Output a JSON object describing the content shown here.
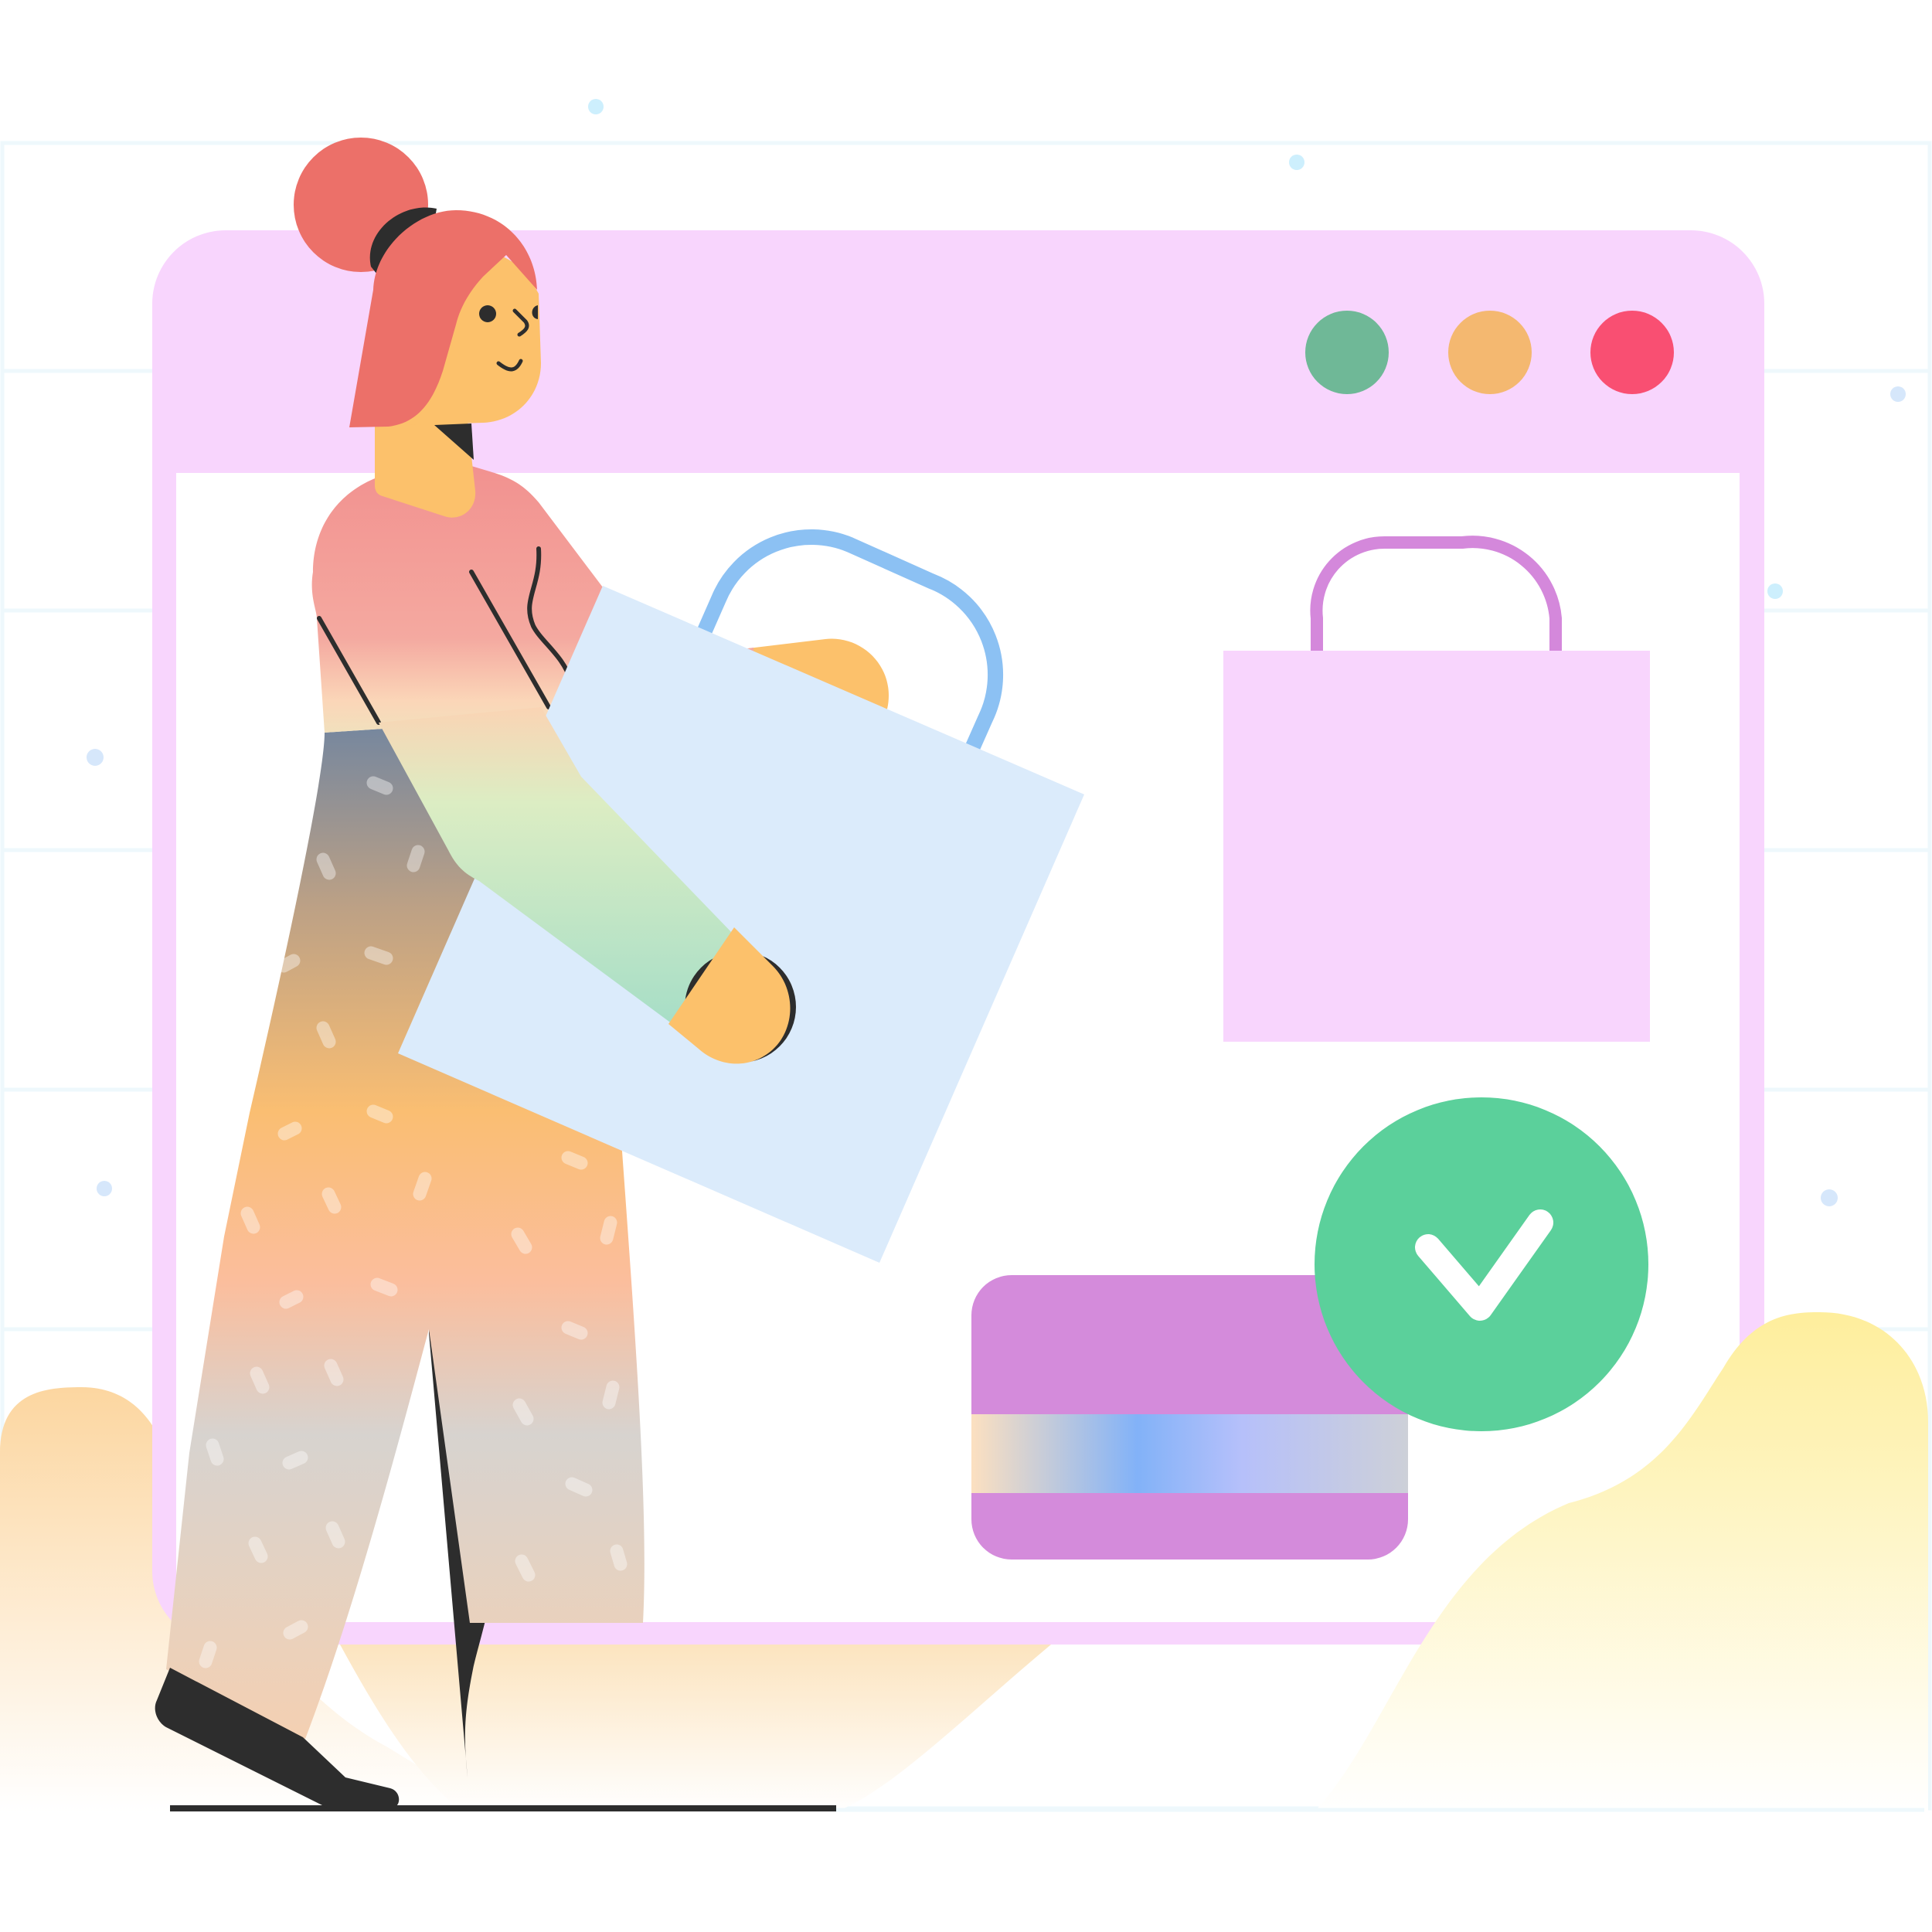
{
  "colors": {
    "background": "#ffffff",
    "grid_line": "#EEF8FC",
    "sparkle": "#CDEFFD",
    "window_frame": "#F8D5FD",
    "window_content": "#ffffff",
    "dot_green": "#6FB897",
    "dot_orange": "#F4B870",
    "dot_red": "#F94F72",
    "bag_pink": "#F8D5FD",
    "bag_pink_handle": "#D488DB",
    "bag_blue": "#DBEBFB",
    "bag_blue_handle": "#8CC1F3",
    "card_purple": "#D48BDB",
    "check_green": "#5BD09B",
    "check_mark": "#ffffff",
    "skin": "#FCC16B",
    "hair": "#EC7069",
    "dark": "#2D2D2D",
    "blob_yellow": "#FEF0A4",
    "blob_peach": "#FCDDA5"
  },
  "illustration": {
    "window_controls": [
      "green-dot",
      "orange-dot",
      "red-dot"
    ],
    "icons": [
      "shopping-bag-icon",
      "shopping-bag-icon",
      "credit-card-icon",
      "check-circle-icon"
    ]
  }
}
